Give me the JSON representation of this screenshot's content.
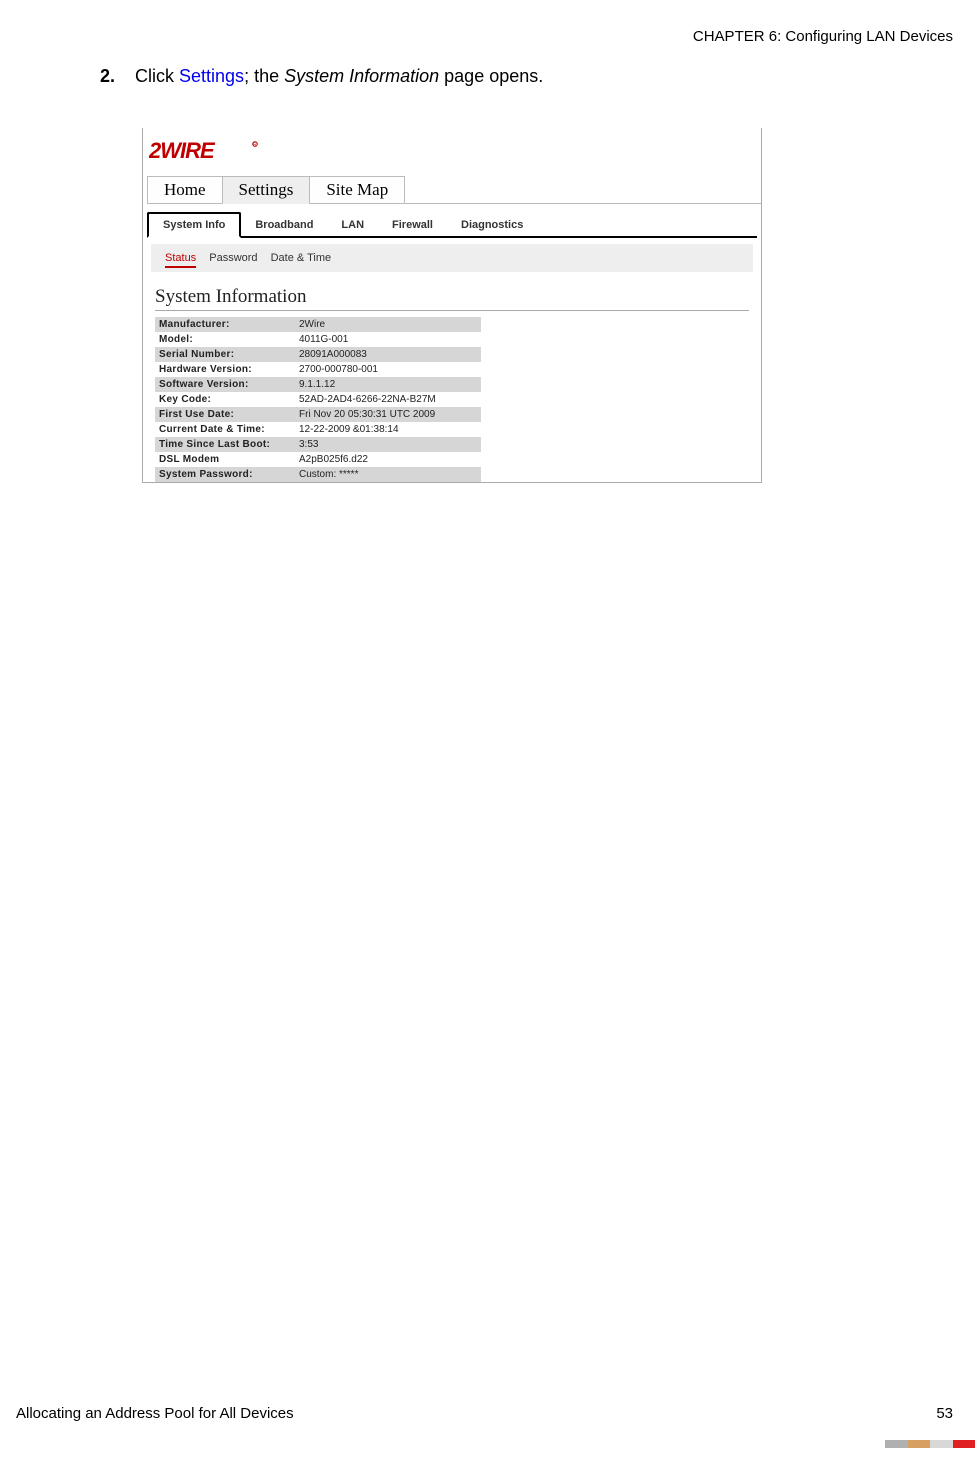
{
  "header": {
    "chapter": "CHAPTER 6: Configuring LAN Devices"
  },
  "step": {
    "num": "2.",
    "pre": "Click ",
    "link": "Settings",
    "mid": "; the ",
    "italic": "System Information",
    "post": " page opens."
  },
  "ui": {
    "logo_top": "2WIRE",
    "top_tabs": {
      "home": "Home",
      "settings": "Settings",
      "sitemap": "Site Map"
    },
    "sub_tabs": {
      "sysinfo": "System Info",
      "broadband": "Broadband",
      "lan": "LAN",
      "firewall": "Firewall",
      "diagnostics": "Diagnostics"
    },
    "subsub": {
      "status": "Status",
      "password": "Password",
      "datetime": "Date & Time"
    },
    "section_title": "System Information",
    "rows": [
      {
        "label": "Manufacturer:",
        "value": "2Wire"
      },
      {
        "label": "Model:",
        "value": "4011G-001"
      },
      {
        "label": "Serial Number:",
        "value": "28091A000083"
      },
      {
        "label": "Hardware Version:",
        "value": "2700-000780-001"
      },
      {
        "label": "Software Version:",
        "value": "9.1.1.12"
      },
      {
        "label": "Key Code:",
        "value": "52AD-2AD4-6266-22NA-B27M"
      },
      {
        "label": "First Use Date:",
        "value": "Fri Nov 20 05:30:31 UTC 2009"
      },
      {
        "label": "Current Date & Time:",
        "value": "12-22-2009 &01:38:14"
      },
      {
        "label": "Time Since Last Boot:",
        "value": "3:53"
      },
      {
        "label": "DSL Modem",
        "value": "A2pB025f6.d22"
      },
      {
        "label": "System Password:",
        "value": "Custom: *****"
      }
    ]
  },
  "footer": {
    "left": "Allocating an Address Pool for All Devices",
    "right": "53"
  }
}
